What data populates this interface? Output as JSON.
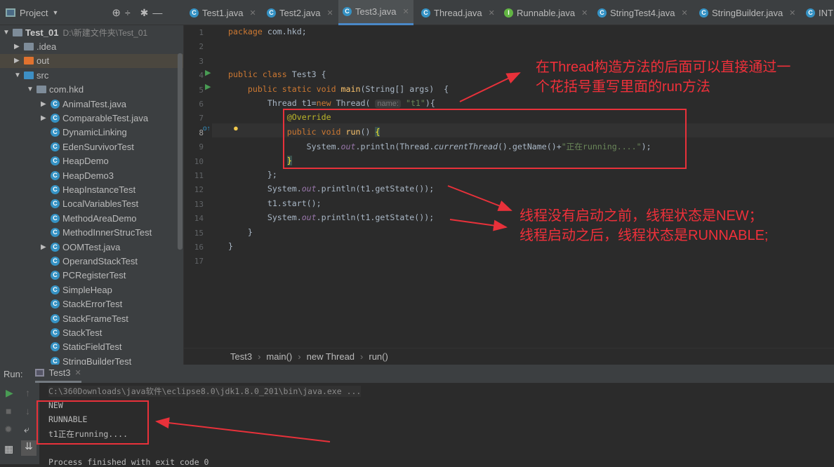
{
  "project_panel": {
    "title": "Project",
    "root": {
      "name": "Test_01",
      "path": "D:\\新建文件夹\\Test_01"
    },
    "items": [
      {
        "label": ".idea",
        "type": "folder",
        "level": 1,
        "arrow": "▶"
      },
      {
        "label": "out",
        "type": "folder-orange",
        "level": 1,
        "arrow": "▶",
        "selected": true
      },
      {
        "label": "src",
        "type": "folder-blue",
        "level": 1,
        "arrow": "▼"
      },
      {
        "label": "com.hkd",
        "type": "package",
        "level": 2,
        "arrow": "▼"
      },
      {
        "label": "AnimalTest.java",
        "type": "class",
        "level": 3,
        "arrow": "▶"
      },
      {
        "label": "ComparableTest.java",
        "type": "class",
        "level": 3,
        "arrow": "▶"
      },
      {
        "label": "DynamicLinking",
        "type": "class",
        "level": 3
      },
      {
        "label": "EdenSurvivorTest",
        "type": "class",
        "level": 3
      },
      {
        "label": "HeapDemo",
        "type": "class",
        "level": 3
      },
      {
        "label": "HeapDemo3",
        "type": "class",
        "level": 3
      },
      {
        "label": "HeapInstanceTest",
        "type": "class",
        "level": 3
      },
      {
        "label": "LocalVariablesTest",
        "type": "class",
        "level": 3
      },
      {
        "label": "MethodAreaDemo",
        "type": "class",
        "level": 3
      },
      {
        "label": "MethodInnerStrucTest",
        "type": "class",
        "level": 3
      },
      {
        "label": "OOMTest.java",
        "type": "class",
        "level": 3,
        "arrow": "▶"
      },
      {
        "label": "OperandStackTest",
        "type": "class",
        "level": 3
      },
      {
        "label": "PCRegisterTest",
        "type": "class",
        "level": 3
      },
      {
        "label": "SimpleHeap",
        "type": "class",
        "level": 3
      },
      {
        "label": "StackErrorTest",
        "type": "class",
        "level": 3
      },
      {
        "label": "StackFrameTest",
        "type": "class",
        "level": 3
      },
      {
        "label": "StackTest",
        "type": "class",
        "level": 3
      },
      {
        "label": "StaticFieldTest",
        "type": "class",
        "level": 3
      },
      {
        "label": "StringBuilderTest",
        "type": "class",
        "level": 3
      }
    ]
  },
  "tabs": [
    {
      "label": "Test1.java",
      "icon": "class",
      "active": false
    },
    {
      "label": "Test2.java",
      "icon": "class",
      "active": false
    },
    {
      "label": "Test3.java",
      "icon": "class",
      "active": true
    },
    {
      "label": "Thread.java",
      "icon": "class",
      "active": false
    },
    {
      "label": "Runnable.java",
      "icon": "interface",
      "active": false
    },
    {
      "label": "StringTest4.java",
      "icon": "class",
      "active": false
    },
    {
      "label": "StringBuilder.java",
      "icon": "class",
      "active": false
    },
    {
      "label": "INT",
      "icon": "class",
      "active": false
    }
  ],
  "editor": {
    "current_line": 8,
    "lines": [
      [
        [
          "package ",
          "kw"
        ],
        [
          "com.hkd;",
          ""
        ]
      ],
      [],
      [],
      [
        [
          "public class ",
          "kw"
        ],
        [
          "Test3 {",
          ""
        ]
      ],
      [
        [
          "    public static void ",
          "kw"
        ],
        [
          "main",
          "fn"
        ],
        [
          "(String[] args)  {",
          ""
        ]
      ],
      [
        [
          "        Thread t1=",
          ""
        ],
        [
          "new ",
          "kw"
        ],
        [
          "Thread( ",
          ""
        ],
        [
          "name:",
          "hint"
        ],
        [
          " ",
          ""
        ],
        [
          "\"t1\"",
          "str"
        ],
        [
          "){",
          ""
        ]
      ],
      [
        [
          "            @Override",
          "ann"
        ]
      ],
      [
        [
          "            public void ",
          "kw"
        ],
        [
          "run",
          "fn"
        ],
        [
          "() ",
          ""
        ],
        [
          "{",
          "br"
        ]
      ],
      [
        [
          "                System.",
          ""
        ],
        [
          "out",
          "st"
        ],
        [
          ".println(Thread.",
          ""
        ],
        [
          "currentThread",
          "it"
        ],
        [
          "().getName()+",
          ""
        ],
        [
          "\"正在running....\"",
          "str"
        ],
        [
          ");",
          ""
        ]
      ],
      [
        [
          "            ",
          ""
        ],
        [
          "}",
          "br"
        ]
      ],
      [
        [
          "        };",
          ""
        ]
      ],
      [
        [
          "        System.",
          ""
        ],
        [
          "out",
          "st"
        ],
        [
          ".println(t1.getState());",
          ""
        ]
      ],
      [
        [
          "        t1.start();",
          ""
        ]
      ],
      [
        [
          "        System.",
          ""
        ],
        [
          "out",
          "st"
        ],
        [
          ".println(t1.getState());",
          ""
        ]
      ],
      [
        [
          "    }",
          ""
        ]
      ],
      [
        [
          "}",
          ""
        ]
      ],
      []
    ]
  },
  "breadcrumbs": [
    "Test3",
    "main()",
    "new Thread",
    "run()"
  ],
  "run_panel": {
    "label": "Run:",
    "tab": "Test3",
    "console": [
      "C:\\360Downloads\\java软件\\eclipse8.0\\jdk1.8.0_201\\bin\\java.exe ...",
      "NEW",
      "RUNNABLE",
      "t1正在running....",
      "",
      "Process finished with exit code 0"
    ]
  },
  "annotations": {
    "a1": [
      "在Thread构造方法的后面可以直接通过一",
      "个花括号重写里面的run方法"
    ],
    "a2": [
      "线程没有启动之前，线程状态是NEW；",
      "线程启动之后，线程状态是RUNNABLE;"
    ]
  },
  "colors": {
    "annotation_red": "#e8313a",
    "accent": "#4a88c7"
  }
}
